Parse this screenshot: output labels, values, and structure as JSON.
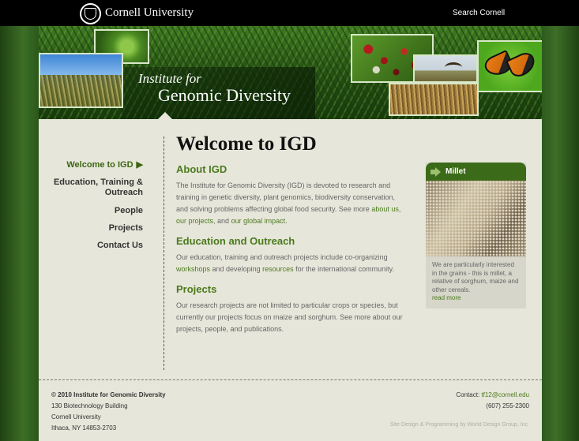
{
  "topbar": {
    "university_name": "Cornell University",
    "search_label": "Search Cornell"
  },
  "banner": {
    "title_line1": "Institute for",
    "title_line2": "Genomic Diversity"
  },
  "nav": {
    "items": [
      {
        "label": "Welcome to IGD",
        "active": true
      },
      {
        "label": "Education, Training &",
        "label2": "Outreach"
      },
      {
        "label": "People"
      },
      {
        "label": "Projects"
      },
      {
        "label": "Contact Us"
      }
    ],
    "active_arrow": "▶"
  },
  "main": {
    "page_title": "Welcome to IGD",
    "sections": [
      {
        "heading": "About IGD",
        "text": "The Institute for Genomic Diversity (IGD) is devoted to research and training in genetic diversity, plant genomics, biodiversity conservation, and solving problems affecting global food security. See more ",
        "link1": "about us",
        "sep": ", ",
        "link2": "our projects",
        "mid": ", and ",
        "link3": "our global impact",
        "end": "."
      },
      {
        "heading": "Education and Outreach",
        "text_a": "Our education, training and outreach projects include co-organizing ",
        "link1": "workshops",
        "text_b": " and developing ",
        "link2": "resources",
        "text_c": " for the international community."
      },
      {
        "heading": "Projects",
        "text": "Our research projects are not limited to particular crops or species, but currently our projects focus on maize and sorghum. See more about our projects, people, and publications."
      }
    ]
  },
  "card": {
    "title": "Millet",
    "text": "We are particularly interested in the grains - this is millet, a relative of sorghum, maize and other cereals.",
    "link": "read more"
  },
  "footer": {
    "org": "© 2010 Institute for Genomic Diversity",
    "addr1": "130 Biotechnology Building",
    "addr2": "Cornell University",
    "addr3": "Ithaca, NY 14853-2703",
    "contact_label": "Contact: ",
    "email": "tf12@cornell.edu",
    "phone": "(607) 255-2300",
    "credits": "Site Design & Programming by World Design Group, Inc."
  },
  "colors": {
    "accent": "#4a7a1c",
    "topbar": "#000000",
    "content_bg": "#e7e6da"
  }
}
